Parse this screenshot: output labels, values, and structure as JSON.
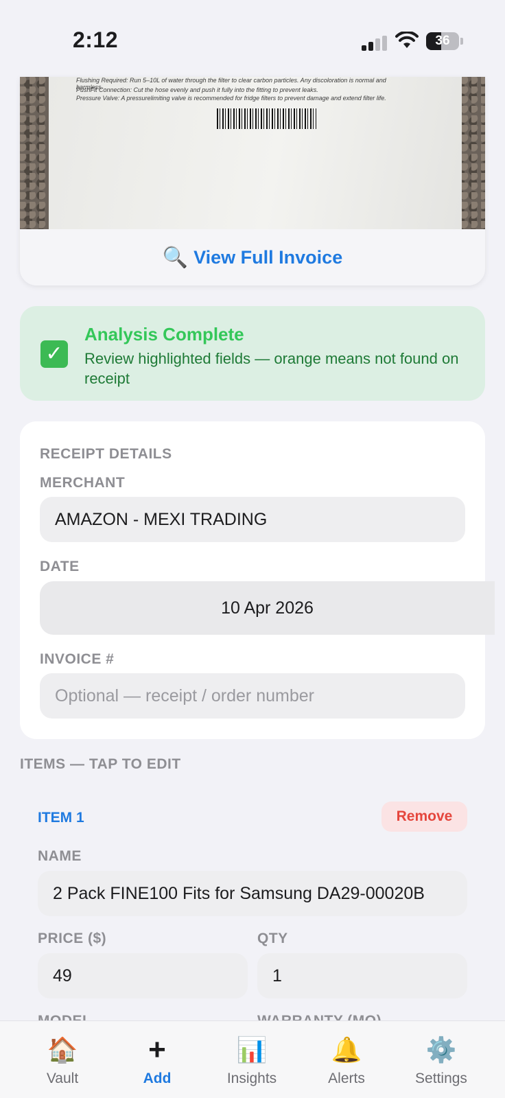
{
  "status_bar": {
    "time": "2:12",
    "battery": "36"
  },
  "invoice_preview": {
    "text_lines": [
      "Flushing Required: Run 5–10L of water through the filter to clear carbon particles. Any discoloration is normal and",
      "harmless.",
      "PushFit Connection: Cut the hose evenly and push it fully into the fitting to prevent leaks.",
      "Pressure Valve: A pressurelimiting valve is recommended for fridge filters to prevent damage and extend filter life."
    ],
    "view_full_label": "View Full Invoice",
    "view_icon": "magnifying-glass-icon"
  },
  "analysis": {
    "title": "Analysis Complete",
    "description": "Review highlighted fields — orange means not found on receipt",
    "icon": "checkmark-icon"
  },
  "receipt_details": {
    "section_title": "RECEIPT DETAILS",
    "merchant_label": "MERCHANT",
    "merchant_value": "AMAZON - MEXI TRADING",
    "date_label": "DATE",
    "date_value": "10 Apr 2026",
    "invoice_label": "INVOICE #",
    "invoice_placeholder": "Optional — receipt / order number"
  },
  "items": {
    "section_title": "ITEMS — TAP TO EDIT",
    "list": [
      {
        "title": "ITEM 1",
        "remove_label": "Remove",
        "name_label": "NAME",
        "name_value": "2 Pack FINE100 Fits for Samsung DA29-00020B",
        "price_label": "PRICE ($)",
        "price_value": "49",
        "qty_label": "QTY",
        "qty_value": "1",
        "model_label": "MODEL",
        "warranty_label": "WARRANTY (MO)"
      }
    ]
  },
  "tab_bar": {
    "tabs": [
      {
        "label": "Vault",
        "icon": "house-icon",
        "active": false
      },
      {
        "label": "Add",
        "icon": "plus-icon",
        "active": true
      },
      {
        "label": "Insights",
        "icon": "bar-chart-icon",
        "active": false
      },
      {
        "label": "Alerts",
        "icon": "bell-icon",
        "active": false
      },
      {
        "label": "Settings",
        "icon": "gear-icon",
        "active": false
      }
    ]
  },
  "colors": {
    "accent": "#1f7ae0",
    "success": "#34c759",
    "success_bg": "#dcefe3",
    "danger": "#e5463d",
    "background": "#f2f2f7"
  }
}
